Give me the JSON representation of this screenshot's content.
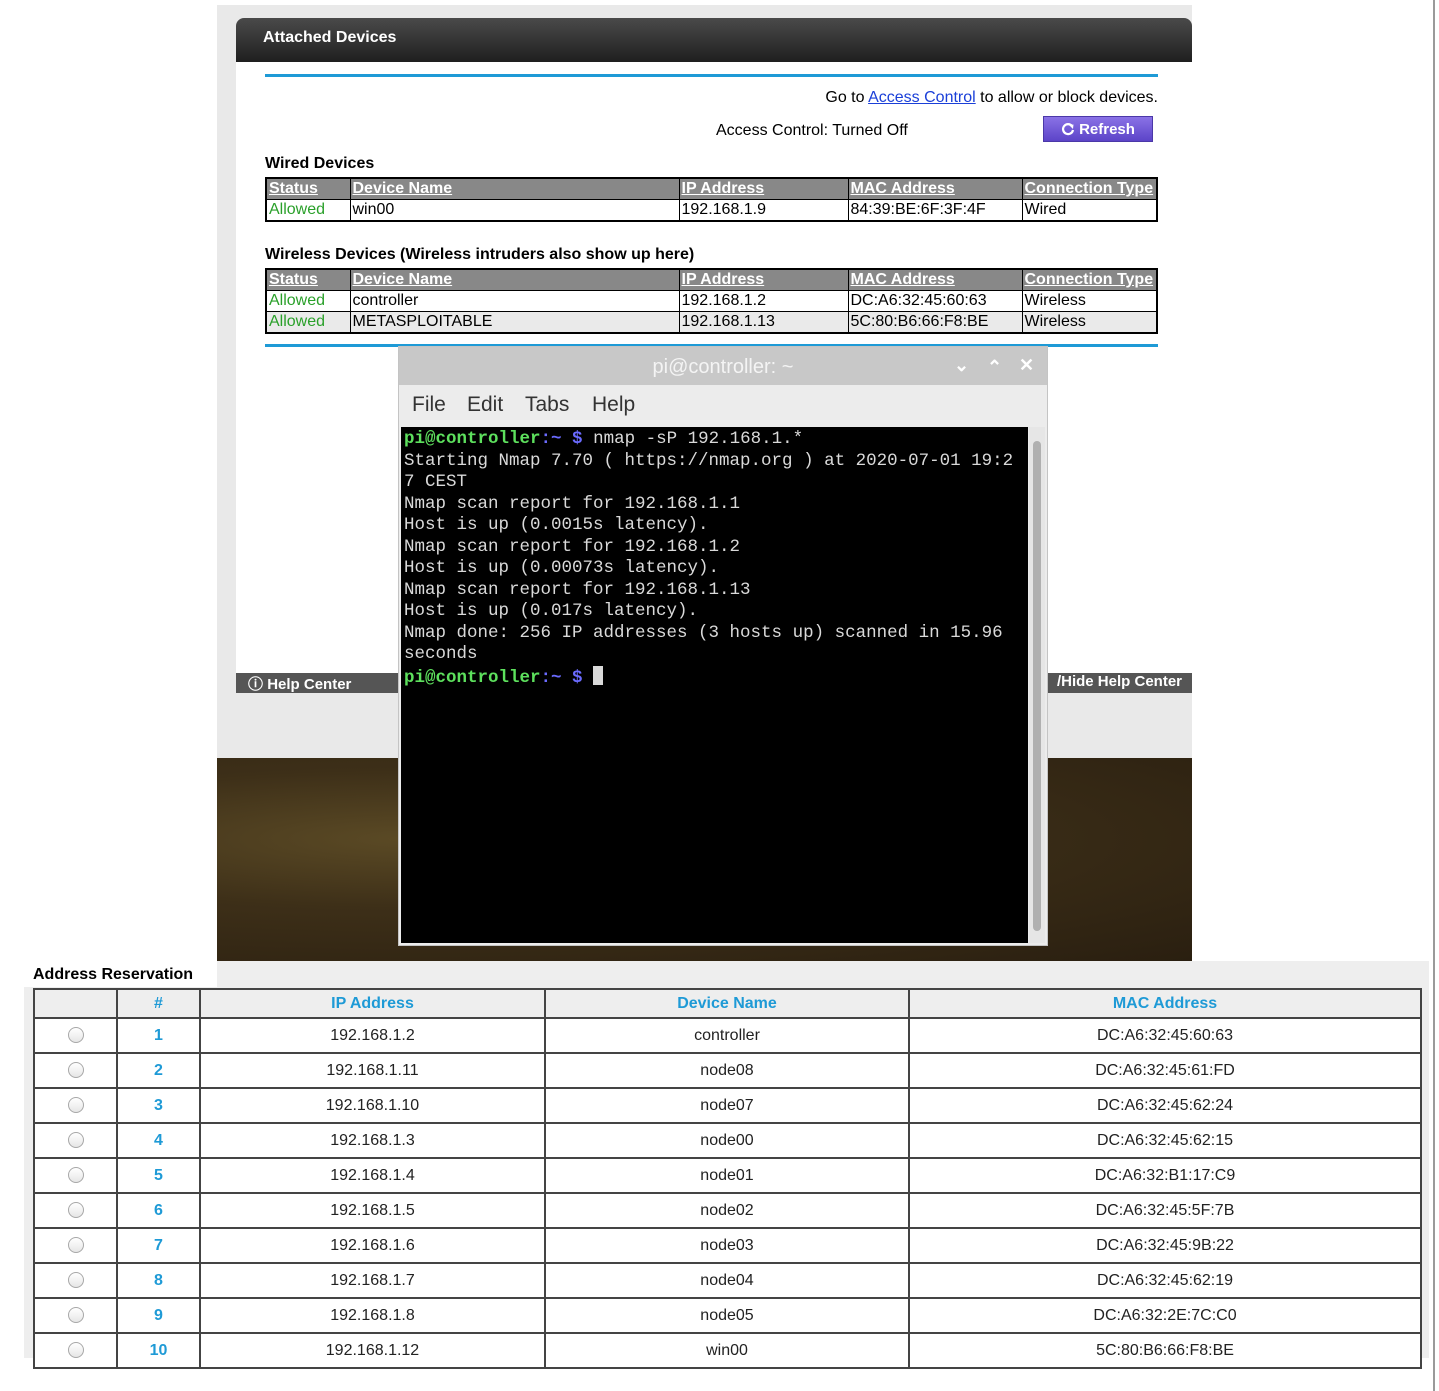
{
  "router": {
    "title": "Attached Devices",
    "access_prefix": "Go to ",
    "access_link": "Access Control",
    "access_suffix": " to allow or block devices.",
    "access_status": "Access Control: Turned Off",
    "refresh_label": "Refresh",
    "help_center": "Help Center",
    "hide_help": "/Hide Help Center",
    "wired": {
      "title": "Wired Devices",
      "headers": [
        "Status",
        "Device Name",
        "IP Address",
        "MAC Address",
        "Connection Type"
      ],
      "rows": [
        [
          "Allowed",
          "win00",
          "192.168.1.9",
          "84:39:BE:6F:3F:4F",
          "Wired"
        ]
      ]
    },
    "wireless": {
      "title": "Wireless Devices (Wireless intruders also show up here)",
      "headers": [
        "Status",
        "Device Name",
        "IP Address",
        "MAC Address",
        "Connection Type"
      ],
      "rows": [
        [
          "Allowed",
          "controller",
          "192.168.1.2",
          "DC:A6:32:45:60:63",
          "Wireless"
        ],
        [
          "Allowed",
          "METASPLOITABLE",
          "192.168.1.13",
          "5C:80:B6:66:F8:BE",
          "Wireless"
        ]
      ]
    }
  },
  "terminal": {
    "title": "pi@controller: ~",
    "menu": [
      "File",
      "Edit",
      "Tabs",
      "Help"
    ],
    "prompt_user": "pi@controller",
    "prompt_path": ":~ ",
    "prompt_dollar": "$",
    "command": " nmap -sP 192.168.1.*",
    "output": [
      "Starting Nmap 7.70 ( https://nmap.org ) at 2020-07-01 19:2",
      "7 CEST",
      "Nmap scan report for 192.168.1.1",
      "Host is up (0.0015s latency).",
      "Nmap scan report for 192.168.1.2",
      "Host is up (0.00073s latency).",
      "Nmap scan report for 192.168.1.13",
      "Host is up (0.017s latency).",
      "Nmap done: 256 IP addresses (3 hosts up) scanned in 15.96",
      "seconds"
    ]
  },
  "reservation": {
    "title": "Address Reservation",
    "headers": [
      "",
      "#",
      "IP Address",
      "Device Name",
      "MAC Address"
    ],
    "rows": [
      [
        "1",
        "192.168.1.2",
        "controller",
        "DC:A6:32:45:60:63"
      ],
      [
        "2",
        "192.168.1.11",
        "node08",
        "DC:A6:32:45:61:FD"
      ],
      [
        "3",
        "192.168.1.10",
        "node07",
        "DC:A6:32:45:62:24"
      ],
      [
        "4",
        "192.168.1.3",
        "node00",
        "DC:A6:32:45:62:15"
      ],
      [
        "5",
        "192.168.1.4",
        "node01",
        "DC:A6:32:B1:17:C9"
      ],
      [
        "6",
        "192.168.1.5",
        "node02",
        "DC:A6:32:45:5F:7B"
      ],
      [
        "7",
        "192.168.1.6",
        "node03",
        "DC:A6:32:45:9B:22"
      ],
      [
        "8",
        "192.168.1.7",
        "node04",
        "DC:A6:32:45:62:19"
      ],
      [
        "9",
        "192.168.1.8",
        "node05",
        "DC:A6:32:2E:7C:C0"
      ],
      [
        "10",
        "192.168.1.12",
        "win00",
        "5C:80:B6:66:F8:BE"
      ]
    ]
  },
  "colors": {
    "accent_blue": "#1e9ad6",
    "allowed_green": "#2aa02a",
    "refresh_purple": "#6b52d6",
    "prompt_green": "#5de05d"
  }
}
